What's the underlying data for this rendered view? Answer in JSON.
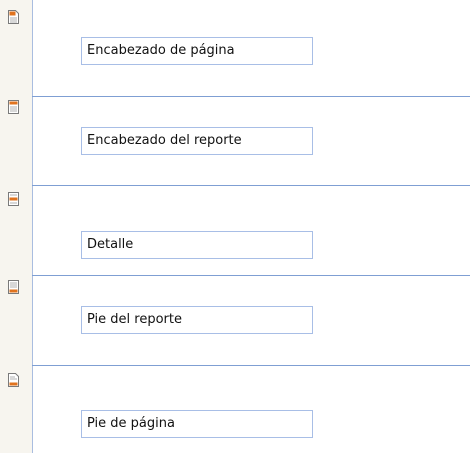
{
  "bands": [
    {
      "id": "page-header",
      "label": "Encabezado de página",
      "icon": "page-header-icon"
    },
    {
      "id": "report-header",
      "label": "Encabezado del reporte",
      "icon": "report-header-icon"
    },
    {
      "id": "detail",
      "label": "Detalle",
      "icon": "detail-icon"
    },
    {
      "id": "report-footer",
      "label": "Pie del reporte",
      "icon": "report-footer-icon"
    },
    {
      "id": "page-footer",
      "label": "Pie de página",
      "icon": "page-footer-icon"
    }
  ],
  "colors": {
    "gutter": "#f7f5ef",
    "divider": "#7f9fd3",
    "field_border": "#a8bee6",
    "icon_accent": "#e0731e"
  }
}
